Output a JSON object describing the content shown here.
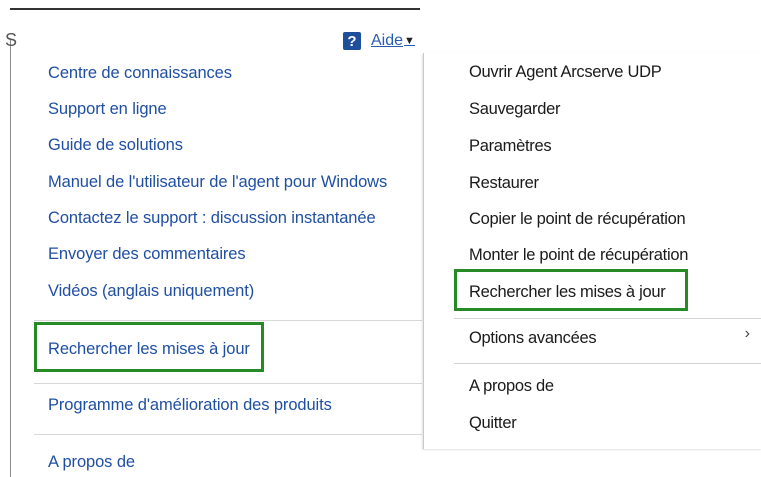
{
  "header": {
    "stray_letter": "S",
    "help_icon": "question-mark-icon",
    "aide_label": "Aide"
  },
  "help_menu": {
    "items": [
      "Centre de connaissances",
      "Support en ligne",
      "Guide de solutions",
      "Manuel de l'utilisateur de l'agent pour Windows",
      "Contactez le support : discussion instantanée",
      "Envoyer des commentaires",
      "Vidéos (anglais uniquement)",
      "Rechercher les mises à jour",
      "Programme d'amélioration des produits",
      "A propos de"
    ]
  },
  "tray_menu": {
    "items": [
      "Ouvrir Agent Arcserve UDP",
      "Sauvegarder",
      "Paramètres",
      "Restaurer",
      "Copier le point de récupération",
      "Monter le point de récupération",
      "Rechercher les mises à jour",
      "Options avancées",
      "A propos de",
      "Quitter"
    ],
    "submenu_icon": "chevron-right-icon"
  },
  "colors": {
    "link": "#1f4fa3",
    "highlight": "#268b26",
    "help_icon_bg": "#1f4f9a"
  }
}
